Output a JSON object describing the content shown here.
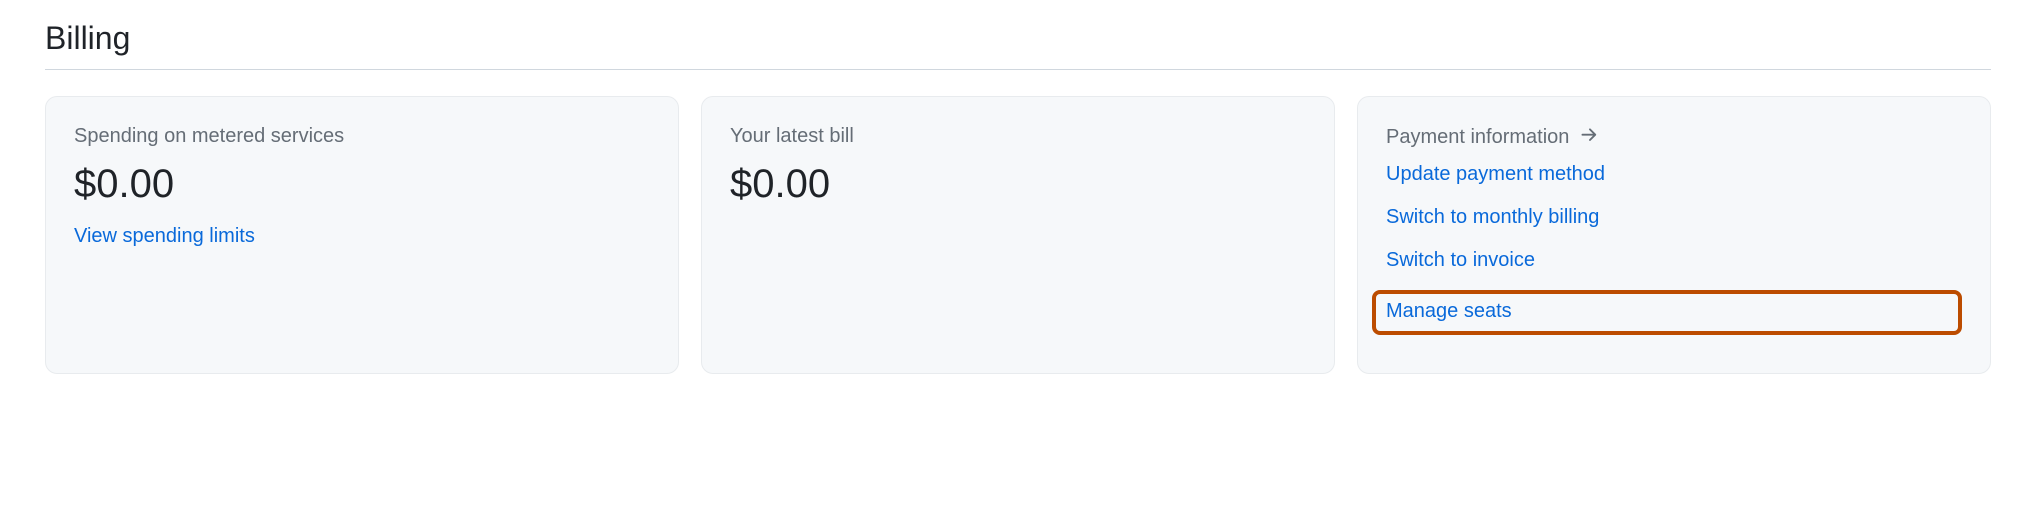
{
  "page": {
    "title": "Billing"
  },
  "cards": {
    "spending": {
      "label": "Spending on metered services",
      "amount": "$0.00",
      "link": "View spending limits"
    },
    "latest_bill": {
      "label": "Your latest bill",
      "amount": "$0.00"
    },
    "payment_info": {
      "label": "Payment information",
      "links": {
        "update_payment": "Update payment method",
        "switch_monthly": "Switch to monthly billing",
        "switch_invoice": "Switch to invoice",
        "manage_seats": "Manage seats"
      }
    }
  }
}
